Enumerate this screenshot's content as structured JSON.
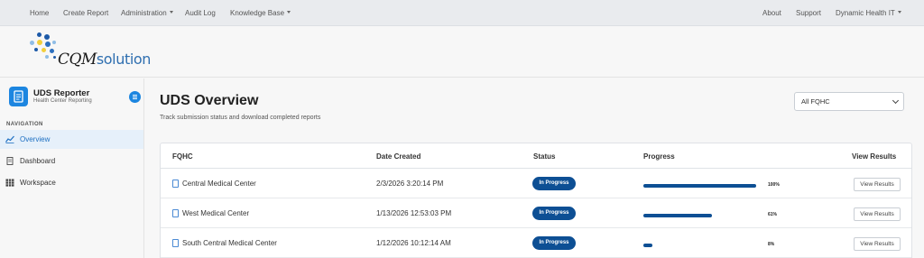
{
  "topnav": {
    "left": [
      {
        "label": "Home",
        "dropdown": false
      },
      {
        "label": "Create Report",
        "dropdown": false
      },
      {
        "label": "Administration",
        "dropdown": true
      },
      {
        "label": "Audit Log",
        "dropdown": false
      },
      {
        "label": "Knowledge Base",
        "dropdown": true
      }
    ],
    "right": [
      {
        "label": "About",
        "dropdown": false
      },
      {
        "label": "Support",
        "dropdown": false
      },
      {
        "label": "Dynamic Health IT",
        "dropdown": true
      }
    ]
  },
  "logo": {
    "prefix": "CQM",
    "suffix": "solution"
  },
  "sidebar": {
    "title": "UDS Reporter",
    "subtitle": "Health Center Reporting",
    "section": "NAVIGATION",
    "items": [
      {
        "label": "Overview",
        "icon": "chart-line-icon",
        "active": true
      },
      {
        "label": "Dashboard",
        "icon": "document-icon",
        "active": false
      },
      {
        "label": "Workspace",
        "icon": "grid-icon",
        "active": false
      }
    ]
  },
  "main": {
    "title": "UDS Overview",
    "subtitle": "Track submission status and download completed reports",
    "filter": {
      "selected": "All FQHC"
    },
    "table": {
      "headers": [
        "FQHC",
        "Date Created",
        "Status",
        "Progress",
        "View Results"
      ],
      "rows": [
        {
          "fqhc": "Central Medical Center",
          "date": "2/3/2026 3:20:14 PM",
          "status": "In Progress",
          "progress": 100,
          "progress_label": "100%",
          "action": "View Results"
        },
        {
          "fqhc": "West Medical Center",
          "date": "1/13/2026 12:53:03 PM",
          "status": "In Progress",
          "progress": 61,
          "progress_label": "61%",
          "action": "View Results"
        },
        {
          "fqhc": "South Central Medical Center",
          "date": "1/12/2026 10:12:14 AM",
          "status": "In Progress",
          "progress": 8,
          "progress_label": "8%",
          "action": "View Results"
        }
      ]
    }
  },
  "colors": {
    "accent": "#1d86e0",
    "badge": "#0d4f94",
    "progress": "#0d4f94"
  }
}
